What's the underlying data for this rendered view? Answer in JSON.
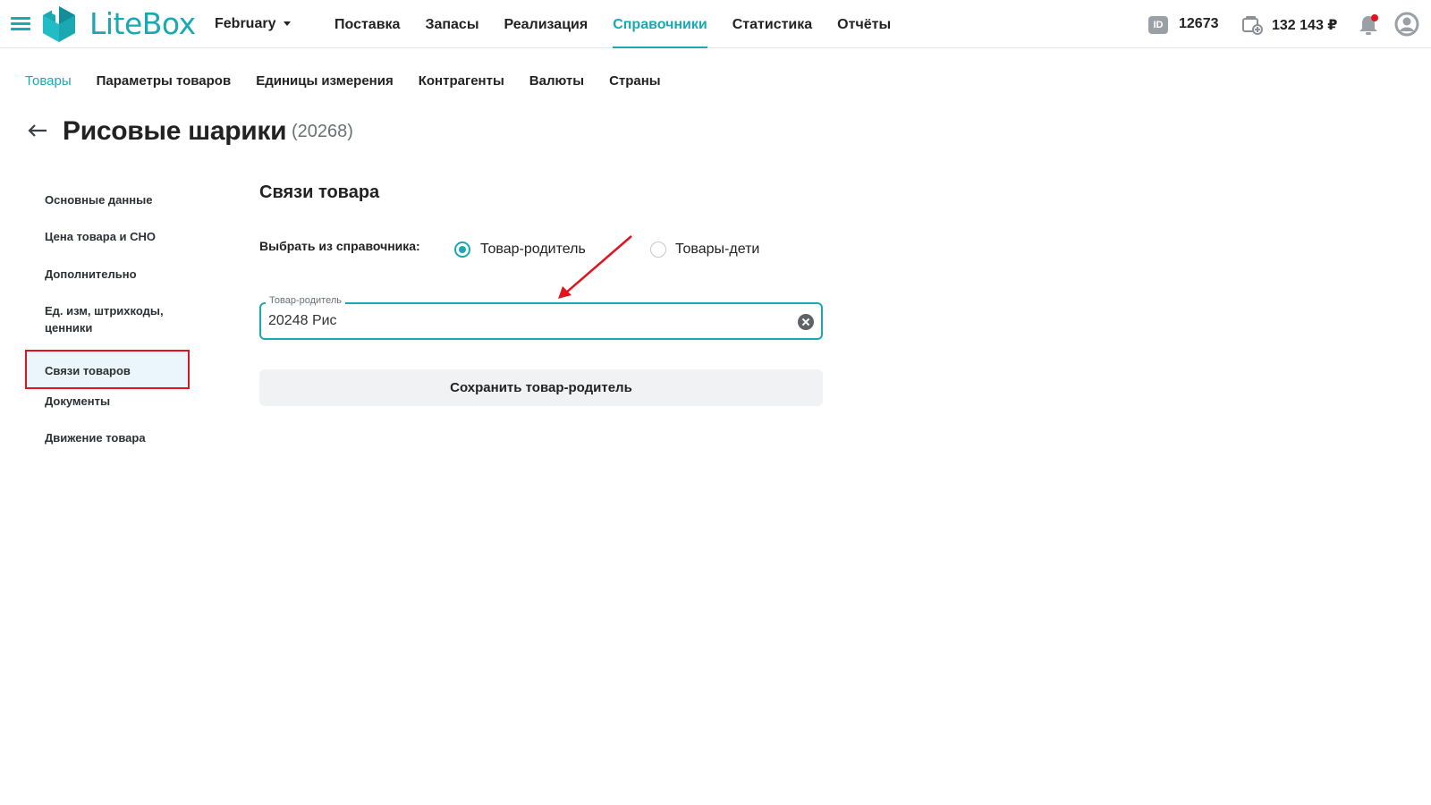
{
  "app": {
    "logo_text": "LiteBox",
    "accent_color": "#1aa8b3",
    "highlight_color": "#e0141e"
  },
  "topbar": {
    "month": "February",
    "nav": [
      "Поставка",
      "Запасы",
      "Реализация",
      "Справочники",
      "Статистика",
      "Отчёты"
    ],
    "active_nav": "Справочники",
    "id_badge": "ID",
    "id_value": "12673",
    "balance": "132 143 ₽",
    "icons": [
      "menu-icon",
      "id-icon",
      "wallet-icon",
      "bell-icon",
      "user-icon"
    ]
  },
  "subnav": {
    "items": [
      "Товары",
      "Параметры товаров",
      "Единицы измерения",
      "Контрагенты",
      "Валюты",
      "Страны"
    ],
    "active": "Товары"
  },
  "page": {
    "back_icon": "arrow-left-icon",
    "title": "Рисовые шарики",
    "count": "(20268)"
  },
  "sidemenu": {
    "items": [
      "Основные данные",
      "Цена товара и СНО",
      "Дополнительно",
      "Ед. изм, штрихкоды, ценники",
      "Связи товаров",
      "Документы",
      "Движение товара"
    ],
    "active": "Связи товаров"
  },
  "main": {
    "section_title": "Связи товара",
    "choose_label": "Выбрать из справочника:",
    "radio_options": [
      "Товар-родитель",
      "Товары-дети"
    ],
    "selected_option": "Товар-родитель",
    "field_label": "Товар-родитель",
    "field_value": "20248 Рис",
    "save_button": "Сохранить товар-родитель"
  }
}
